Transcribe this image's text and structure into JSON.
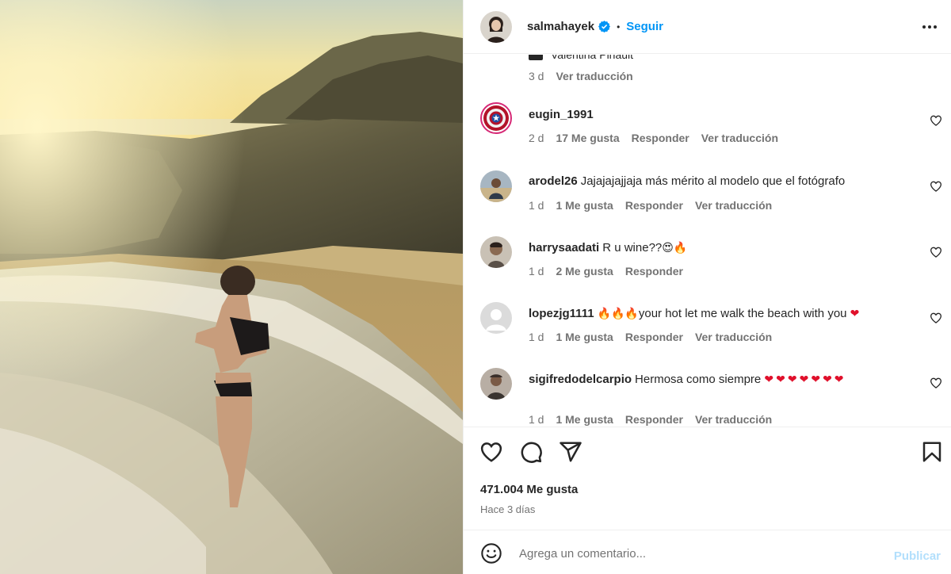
{
  "post": {
    "username": "salmahayek",
    "verified": true,
    "separator": "•",
    "follow_label": "Seguir",
    "more_icon": "more-horizontal-icon"
  },
  "partial_comment": {
    "text": "Valentina Pinault",
    "time": "3 d",
    "translate": "Ver traducción"
  },
  "comments": [
    {
      "username": "eugin_1991",
      "text": "",
      "time": "2 d",
      "likes": "17 Me gusta",
      "reply": "Responder",
      "translate": "Ver traducción",
      "avatar": "captain-america-shield-avatar"
    },
    {
      "username": "arodel26",
      "text": "Jajajajajjaja más mérito al modelo que el fotógrafo",
      "time": "1 d",
      "likes": "1 Me gusta",
      "reply": "Responder",
      "translate": "Ver traducción",
      "avatar": "user-photo-avatar"
    },
    {
      "username": "harrysaadati",
      "text": "R u wine??",
      "emoji": "😍🔥",
      "time": "1 d",
      "likes": "2 Me gusta",
      "reply": "Responder",
      "avatar": "user-photo-avatar"
    },
    {
      "username": "lopezjg1111",
      "emoji_pre": "🔥🔥🔥",
      "text": "your hot let me walk the beach with you",
      "emoji": "❤",
      "time": "1 d",
      "likes": "1 Me gusta",
      "reply": "Responder",
      "translate": "Ver traducción",
      "avatar": "default-avatar"
    },
    {
      "username": "sigifredodelcarpio",
      "text": "Hermosa como siempre",
      "emoji": "❤❤❤❤❤❤❤",
      "time": "1 d",
      "likes": "1 Me gusta",
      "reply": "Responder",
      "translate": "Ver traducción",
      "avatar": "user-photo-avatar"
    }
  ],
  "actions": {
    "like_icon": "heart-icon",
    "comment_icon": "comment-icon",
    "share_icon": "paper-plane-icon",
    "save_icon": "bookmark-icon"
  },
  "stats": {
    "likes": "471.004 Me gusta",
    "date": "Hace 3 días"
  },
  "add_comment": {
    "placeholder": "Agrega un comentario...",
    "publish_label": "Publicar"
  },
  "colors": {
    "accent": "#0095f6",
    "publish_disabled": "#b2dffc",
    "heart_red": "#e0102b",
    "muted": "#737373",
    "text": "#262626"
  }
}
